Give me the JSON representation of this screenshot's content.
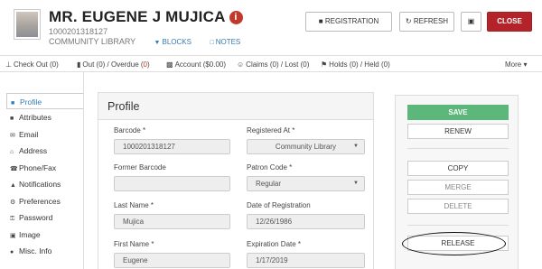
{
  "header": {
    "patron_name": "MR. EUGENE J MUJICA",
    "barcode": "1000201318127",
    "library": "COMMUNITY LIBRARY",
    "blocks_link": "BLOCKS",
    "notes_link": "NOTES",
    "registration_label": "REGISTRATION",
    "refresh_label": "REFRESH",
    "close_label": "CLOSE"
  },
  "toolbar": {
    "checkout": "Check Out (0)",
    "out_prefix": "Out (0) / Overdue (",
    "overdue_count": "0",
    "out_suffix": ")",
    "account": "Account ($0.00)",
    "claims": "Claims (0) / Lost (0)",
    "holds": "Holds (0) / Held (0)",
    "more": "More"
  },
  "sidebar": {
    "items": [
      {
        "label": "Profile",
        "icon": "user-icon"
      },
      {
        "label": "Attributes",
        "icon": "user-tag-icon"
      },
      {
        "label": "Email",
        "icon": "envelope-icon"
      },
      {
        "label": "Address",
        "icon": "home-icon"
      },
      {
        "label": "Phone/Fax",
        "icon": "phone-icon"
      },
      {
        "label": "Notifications",
        "icon": "bell-icon"
      },
      {
        "label": "Preferences",
        "icon": "cogs-icon"
      },
      {
        "label": "Password",
        "icon": "key-icon"
      },
      {
        "label": "Image",
        "icon": "image-icon"
      },
      {
        "label": "Misc. Info",
        "icon": "info-circle-icon"
      }
    ]
  },
  "profile": {
    "title": "Profile",
    "barcode_label": "Barcode *",
    "barcode_value": "1000201318127",
    "registered_at_label": "Registered At *",
    "registered_at_value": "Community Library",
    "former_barcode_label": "Former Barcode",
    "former_barcode_value": "",
    "patron_code_label": "Patron Code *",
    "patron_code_value": "Regular",
    "last_name_label": "Last Name *",
    "last_name_value": "Mujica",
    "reg_date_label": "Date of Registration",
    "reg_date_value": "12/26/1986",
    "first_name_label": "First Name *",
    "first_name_value": "Eugene",
    "exp_date_label": "Expiration Date *",
    "exp_date_value": "1/17/2019"
  },
  "actions": {
    "save": "SAVE",
    "renew": "RENEW",
    "copy": "COPY",
    "merge": "MERGE",
    "delete": "DELETE",
    "release": "RELEASE"
  },
  "colors": {
    "close_button": "#b4232a",
    "save_button": "#5cb87a",
    "link": "#337ab7"
  }
}
